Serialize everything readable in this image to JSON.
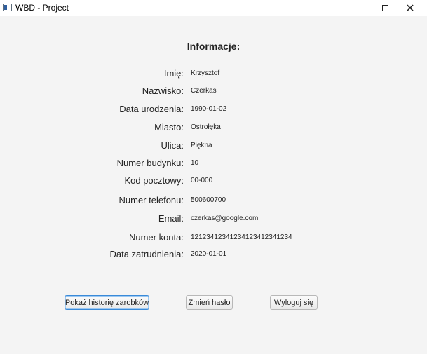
{
  "window": {
    "title": "WBD - Project",
    "minimize_icon": "minimize-icon",
    "maximize_icon": "maximize-icon",
    "close_icon": "close-icon"
  },
  "info": {
    "heading": "Informacje:",
    "rows": [
      {
        "label": "Imię:",
        "value": "Krzysztof"
      },
      {
        "label": "Nazwisko:",
        "value": "Czerkas"
      },
      {
        "label": "Data urodzenia:",
        "value": "1990-01-02"
      },
      {
        "label": "Miasto:",
        "value": "Ostrołęka"
      },
      {
        "label": "Ulica:",
        "value": "Piękna"
      },
      {
        "label": "Numer budynku:",
        "value": "10"
      },
      {
        "label": "Kod pocztowy:",
        "value": "00-000"
      },
      {
        "label": "Numer telefonu:",
        "value": "500600700"
      },
      {
        "label": "Email:",
        "value": "czerkas@google.com"
      },
      {
        "label": "Numer konta:",
        "value": "12123412341234123412341234"
      },
      {
        "label": "Data zatrudnienia:",
        "value": "2020-01-01"
      }
    ]
  },
  "buttons": {
    "history": "Pokaż historię zarobków",
    "change_password": "Zmień hasło",
    "logout": "Wyloguj się"
  }
}
